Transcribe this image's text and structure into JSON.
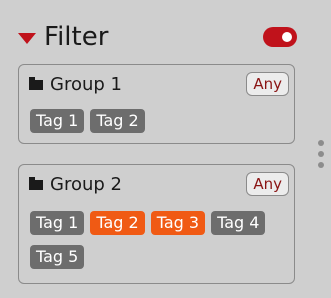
{
  "header": {
    "title": "Filter",
    "caret_icon": "caret-down-icon",
    "toggle_on": true,
    "accent": "#c0121b"
  },
  "groups": [
    {
      "name": "Group 1",
      "match_label": "Any",
      "tags": [
        {
          "label": "Tag 1",
          "selected": false
        },
        {
          "label": "Tag 2",
          "selected": false
        }
      ]
    },
    {
      "name": "Group 2",
      "match_label": "Any",
      "tags": [
        {
          "label": "Tag 1",
          "selected": false
        },
        {
          "label": "Tag 2",
          "selected": true
        },
        {
          "label": "Tag 3",
          "selected": true
        },
        {
          "label": "Tag 4",
          "selected": false
        },
        {
          "label": "Tag 5",
          "selected": false
        }
      ]
    }
  ],
  "colors": {
    "tag_default": "#6d6d6d",
    "tag_selected": "#f05a14"
  },
  "icons": {
    "group_icon": "folder-icon",
    "scroll_handle": "drag-handle-icon"
  }
}
